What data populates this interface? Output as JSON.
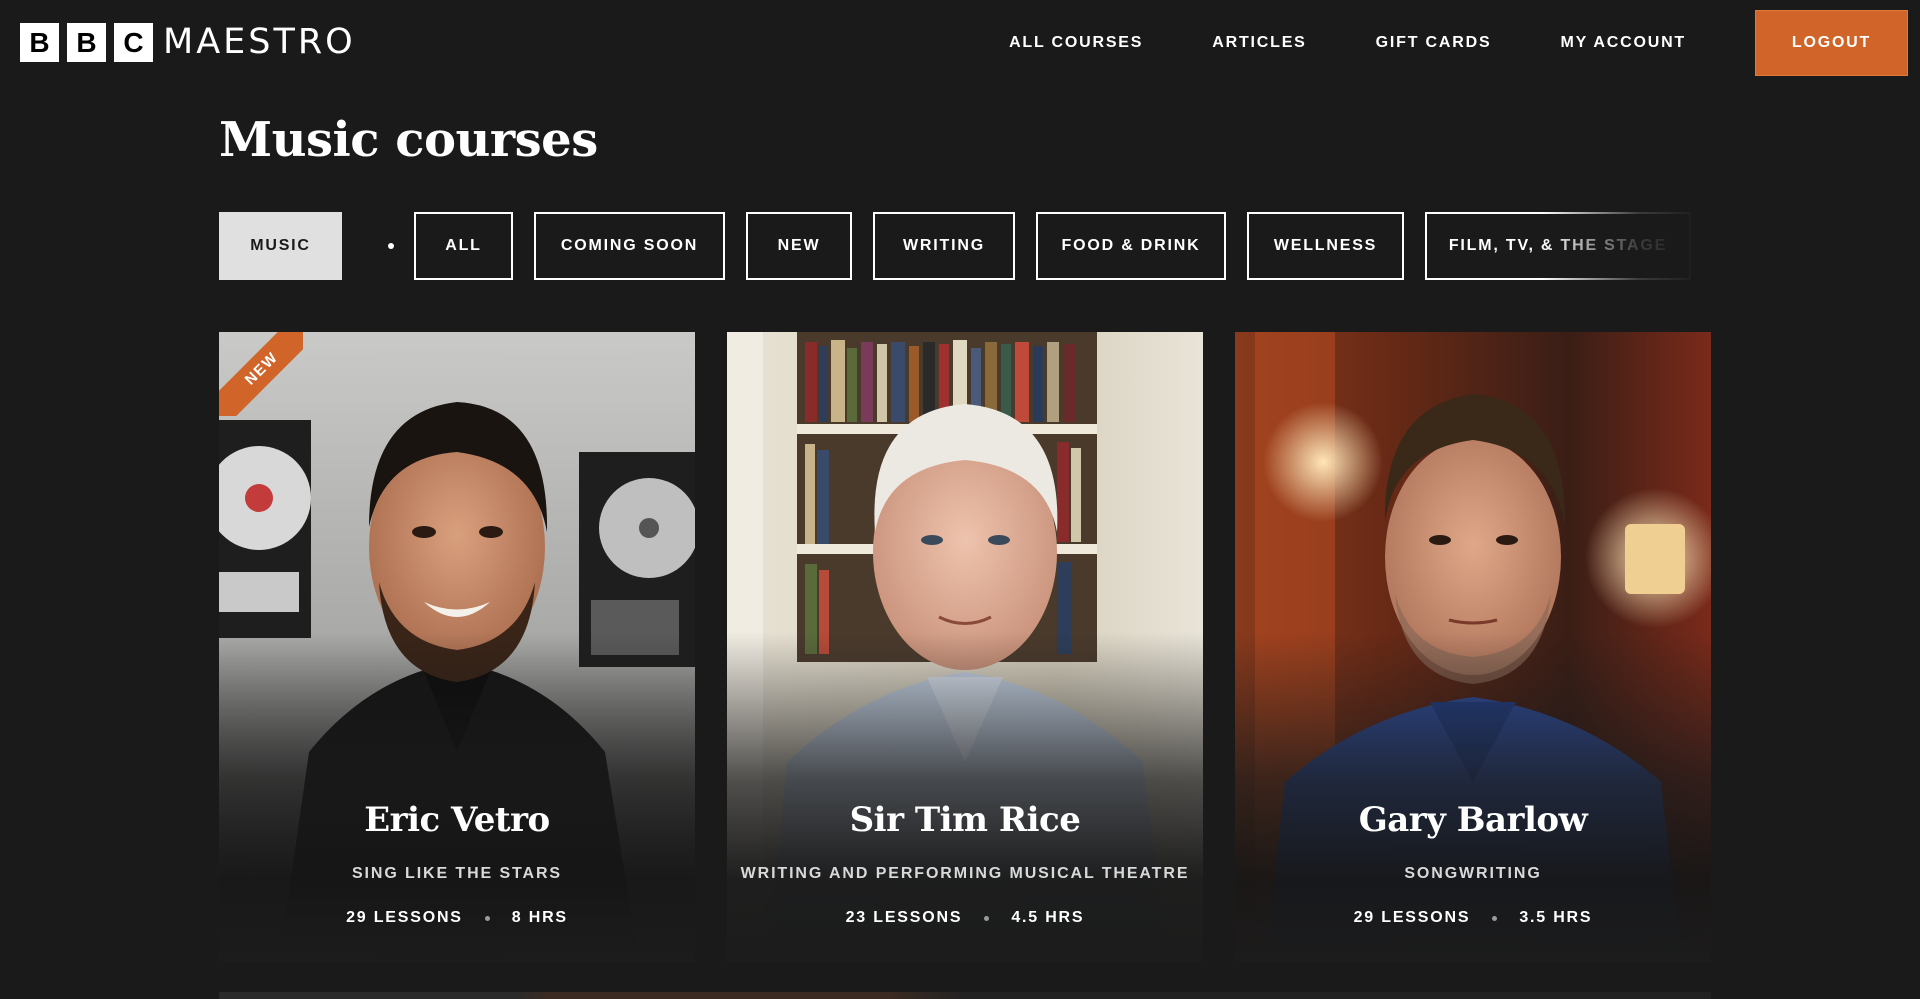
{
  "header": {
    "logo_blocks": [
      "B",
      "B",
      "C"
    ],
    "logo_word": "MAESTRO",
    "nav": [
      {
        "label": "ALL COURSES"
      },
      {
        "label": "ARTICLES"
      },
      {
        "label": "GIFT CARDS"
      },
      {
        "label": "MY ACCOUNT"
      }
    ],
    "logout_label": "LOGOUT"
  },
  "page_title": "Music courses",
  "filters": {
    "active": "MUSIC",
    "items": [
      "ALL",
      "COMING SOON",
      "NEW",
      "WRITING",
      "FOOD & DRINK",
      "WELLNESS",
      "FILM, TV, & THE STAGE"
    ]
  },
  "cards": [
    {
      "name": "Eric Vetro",
      "subtitle": "SING LIKE THE STARS",
      "lessons": "29 LESSONS",
      "hours": "8 HRS",
      "badge": "NEW"
    },
    {
      "name": "Sir Tim Rice",
      "subtitle": "WRITING AND PERFORMING MUSICAL THEATRE",
      "lessons": "23 LESSONS",
      "hours": "4.5 HRS"
    },
    {
      "name": "Gary Barlow",
      "subtitle": "SONGWRITING",
      "lessons": "29 LESSONS",
      "hours": "3.5 HRS"
    }
  ],
  "colors": {
    "background": "#1a1a1a",
    "accent": "#d06429",
    "active_filter_bg": "#e0e0e0"
  }
}
